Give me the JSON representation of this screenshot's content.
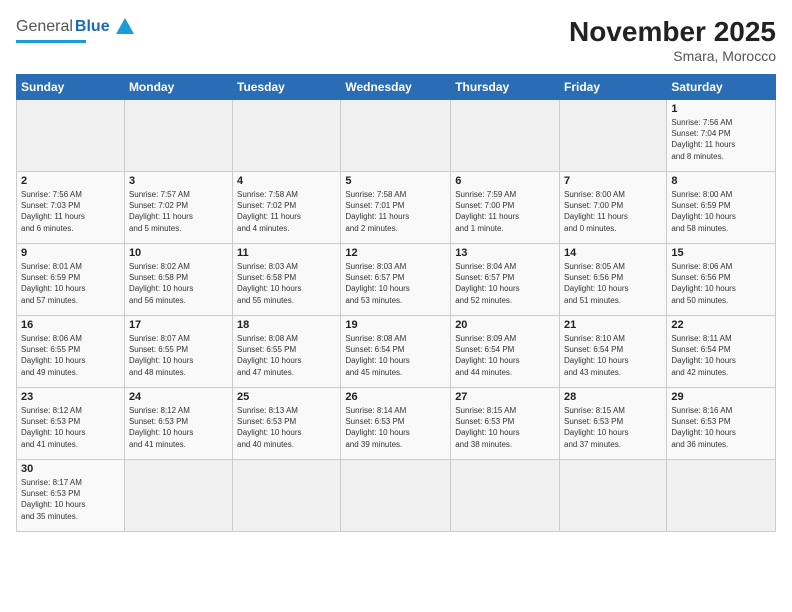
{
  "header": {
    "title": "November 2025",
    "subtitle": "Smara, Morocco",
    "logo_general": "General",
    "logo_blue": "Blue"
  },
  "days_of_week": [
    "Sunday",
    "Monday",
    "Tuesday",
    "Wednesday",
    "Thursday",
    "Friday",
    "Saturday"
  ],
  "weeks": [
    [
      {
        "day": "",
        "info": ""
      },
      {
        "day": "",
        "info": ""
      },
      {
        "day": "",
        "info": ""
      },
      {
        "day": "",
        "info": ""
      },
      {
        "day": "",
        "info": ""
      },
      {
        "day": "",
        "info": ""
      },
      {
        "day": "1",
        "info": "Sunrise: 7:56 AM\nSunset: 7:04 PM\nDaylight: 11 hours\nand 8 minutes."
      }
    ],
    [
      {
        "day": "2",
        "info": "Sunrise: 7:56 AM\nSunset: 7:03 PM\nDaylight: 11 hours\nand 6 minutes."
      },
      {
        "day": "3",
        "info": "Sunrise: 7:57 AM\nSunset: 7:02 PM\nDaylight: 11 hours\nand 5 minutes."
      },
      {
        "day": "4",
        "info": "Sunrise: 7:58 AM\nSunset: 7:02 PM\nDaylight: 11 hours\nand 4 minutes."
      },
      {
        "day": "5",
        "info": "Sunrise: 7:58 AM\nSunset: 7:01 PM\nDaylight: 11 hours\nand 2 minutes."
      },
      {
        "day": "6",
        "info": "Sunrise: 7:59 AM\nSunset: 7:00 PM\nDaylight: 11 hours\nand 1 minute."
      },
      {
        "day": "7",
        "info": "Sunrise: 8:00 AM\nSunset: 7:00 PM\nDaylight: 11 hours\nand 0 minutes."
      },
      {
        "day": "8",
        "info": "Sunrise: 8:00 AM\nSunset: 6:59 PM\nDaylight: 10 hours\nand 58 minutes."
      }
    ],
    [
      {
        "day": "9",
        "info": "Sunrise: 8:01 AM\nSunset: 6:59 PM\nDaylight: 10 hours\nand 57 minutes."
      },
      {
        "day": "10",
        "info": "Sunrise: 8:02 AM\nSunset: 6:58 PM\nDaylight: 10 hours\nand 56 minutes."
      },
      {
        "day": "11",
        "info": "Sunrise: 8:03 AM\nSunset: 6:58 PM\nDaylight: 10 hours\nand 55 minutes."
      },
      {
        "day": "12",
        "info": "Sunrise: 8:03 AM\nSunset: 6:57 PM\nDaylight: 10 hours\nand 53 minutes."
      },
      {
        "day": "13",
        "info": "Sunrise: 8:04 AM\nSunset: 6:57 PM\nDaylight: 10 hours\nand 52 minutes."
      },
      {
        "day": "14",
        "info": "Sunrise: 8:05 AM\nSunset: 6:56 PM\nDaylight: 10 hours\nand 51 minutes."
      },
      {
        "day": "15",
        "info": "Sunrise: 8:06 AM\nSunset: 6:56 PM\nDaylight: 10 hours\nand 50 minutes."
      }
    ],
    [
      {
        "day": "16",
        "info": "Sunrise: 8:06 AM\nSunset: 6:55 PM\nDaylight: 10 hours\nand 49 minutes."
      },
      {
        "day": "17",
        "info": "Sunrise: 8:07 AM\nSunset: 6:55 PM\nDaylight: 10 hours\nand 48 minutes."
      },
      {
        "day": "18",
        "info": "Sunrise: 8:08 AM\nSunset: 6:55 PM\nDaylight: 10 hours\nand 47 minutes."
      },
      {
        "day": "19",
        "info": "Sunrise: 8:08 AM\nSunset: 6:54 PM\nDaylight: 10 hours\nand 45 minutes."
      },
      {
        "day": "20",
        "info": "Sunrise: 8:09 AM\nSunset: 6:54 PM\nDaylight: 10 hours\nand 44 minutes."
      },
      {
        "day": "21",
        "info": "Sunrise: 8:10 AM\nSunset: 6:54 PM\nDaylight: 10 hours\nand 43 minutes."
      },
      {
        "day": "22",
        "info": "Sunrise: 8:11 AM\nSunset: 6:54 PM\nDaylight: 10 hours\nand 42 minutes."
      }
    ],
    [
      {
        "day": "23",
        "info": "Sunrise: 8:12 AM\nSunset: 6:53 PM\nDaylight: 10 hours\nand 41 minutes."
      },
      {
        "day": "24",
        "info": "Sunrise: 8:12 AM\nSunset: 6:53 PM\nDaylight: 10 hours\nand 41 minutes."
      },
      {
        "day": "25",
        "info": "Sunrise: 8:13 AM\nSunset: 6:53 PM\nDaylight: 10 hours\nand 40 minutes."
      },
      {
        "day": "26",
        "info": "Sunrise: 8:14 AM\nSunset: 6:53 PM\nDaylight: 10 hours\nand 39 minutes."
      },
      {
        "day": "27",
        "info": "Sunrise: 8:15 AM\nSunset: 6:53 PM\nDaylight: 10 hours\nand 38 minutes."
      },
      {
        "day": "28",
        "info": "Sunrise: 8:15 AM\nSunset: 6:53 PM\nDaylight: 10 hours\nand 37 minutes."
      },
      {
        "day": "29",
        "info": "Sunrise: 8:16 AM\nSunset: 6:53 PM\nDaylight: 10 hours\nand 36 minutes."
      }
    ],
    [
      {
        "day": "30",
        "info": "Sunrise: 8:17 AM\nSunset: 6:53 PM\nDaylight: 10 hours\nand 35 minutes."
      },
      {
        "day": "",
        "info": ""
      },
      {
        "day": "",
        "info": ""
      },
      {
        "day": "",
        "info": ""
      },
      {
        "day": "",
        "info": ""
      },
      {
        "day": "",
        "info": ""
      },
      {
        "day": "",
        "info": ""
      }
    ]
  ]
}
